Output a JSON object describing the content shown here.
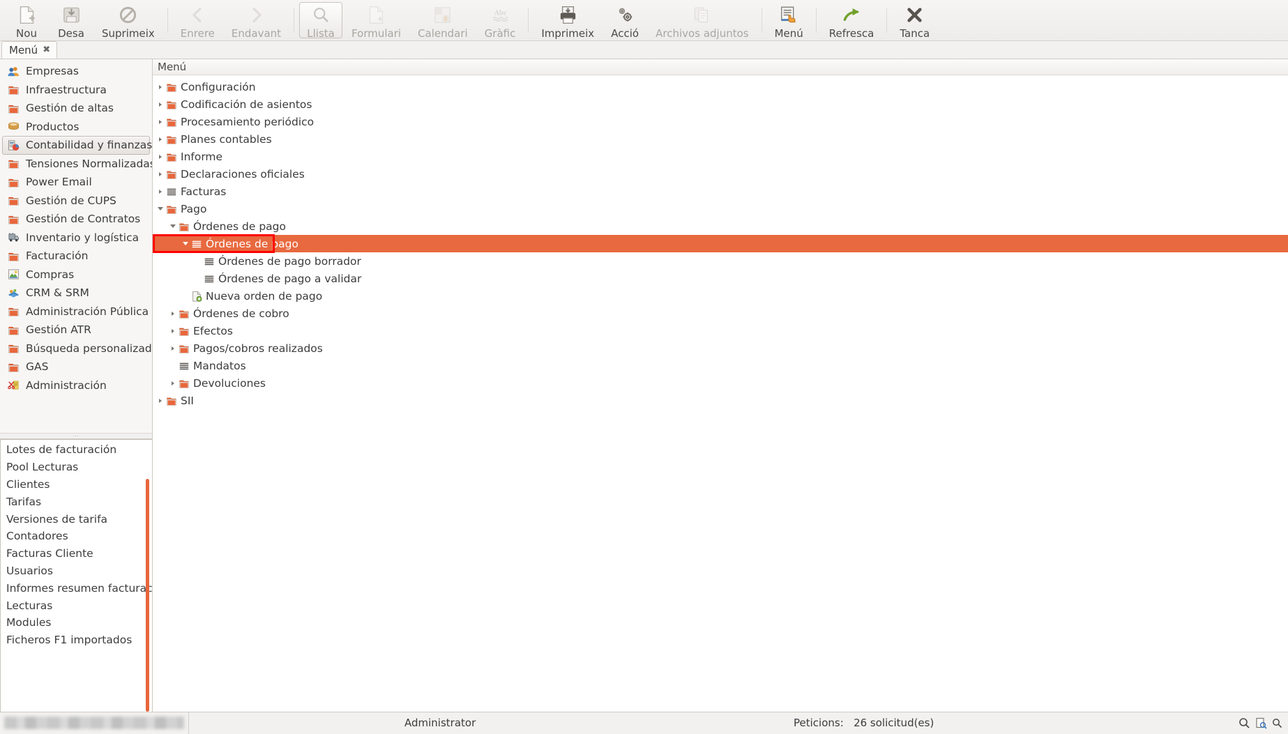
{
  "toolbar": {
    "buttons": [
      {
        "label": "Nou",
        "icon": "new-document-icon",
        "enabled": true,
        "active": false
      },
      {
        "label": "Desa",
        "icon": "save-icon",
        "enabled": true,
        "active": false
      },
      {
        "label": "Suprimeix",
        "icon": "delete-forbidden-icon",
        "enabled": true,
        "active": false
      },
      {
        "label": "Enrere",
        "icon": "chevron-left-icon",
        "enabled": false,
        "active": false
      },
      {
        "label": "Endavant",
        "icon": "chevron-right-icon",
        "enabled": false,
        "active": false
      },
      {
        "label": "Llista",
        "icon": "magnifier-list-icon",
        "enabled": false,
        "active": true
      },
      {
        "label": "Formulari",
        "icon": "form-icon",
        "enabled": false,
        "active": false
      },
      {
        "label": "Calendari",
        "icon": "calendar-icon",
        "enabled": false,
        "active": false
      },
      {
        "label": "Gràfic",
        "icon": "chart-abc-icon",
        "enabled": false,
        "active": false
      },
      {
        "label": "Imprimeix",
        "icon": "printer-icon",
        "enabled": true,
        "active": false
      },
      {
        "label": "Acció",
        "icon": "gears-icon",
        "enabled": true,
        "active": false
      },
      {
        "label": "Archivos adjuntos",
        "icon": "clipboard-icon",
        "enabled": false,
        "active": false
      },
      {
        "label": "Menú",
        "icon": "menu-hand-icon",
        "enabled": true,
        "active": false
      },
      {
        "label": "Refresca",
        "icon": "refresh-arrow-icon",
        "enabled": true,
        "active": false
      },
      {
        "label": "Tanca",
        "icon": "close-x-icon",
        "enabled": true,
        "active": false
      }
    ],
    "separators_after": [
      2,
      4,
      8,
      11,
      12,
      13
    ]
  },
  "tabs": [
    {
      "label": "Menú",
      "close_icon": "✖",
      "active": true
    }
  ],
  "sidebar": {
    "items": [
      {
        "label": "Empresas",
        "icon": "users-icon",
        "selected": false
      },
      {
        "label": "Infraestructura",
        "icon": "folder-icon",
        "selected": false
      },
      {
        "label": "Gestión de altas",
        "icon": "folder-icon",
        "selected": false
      },
      {
        "label": "Productos",
        "icon": "box-icon",
        "selected": false
      },
      {
        "label": "Contabilidad y finanzas",
        "icon": "accounting-icon",
        "selected": true
      },
      {
        "label": "Tensiones Normalizadas",
        "icon": "folder-icon",
        "selected": false
      },
      {
        "label": "Power Email",
        "icon": "folder-icon",
        "selected": false
      },
      {
        "label": "Gestión de CUPS",
        "icon": "folder-icon",
        "selected": false
      },
      {
        "label": "Gestión de Contratos",
        "icon": "folder-icon",
        "selected": false
      },
      {
        "label": "Inventario y logística",
        "icon": "truck-icon",
        "selected": false
      },
      {
        "label": "Facturación",
        "icon": "folder-icon",
        "selected": false
      },
      {
        "label": "Compras",
        "icon": "cart-icon",
        "selected": false
      },
      {
        "label": "CRM & SRM",
        "icon": "crm-icon",
        "selected": false
      },
      {
        "label": "Administración Pública",
        "icon": "folder-icon",
        "selected": false
      },
      {
        "label": "Gestión ATR",
        "icon": "folder-icon",
        "selected": false
      },
      {
        "label": "Búsqueda personalizada",
        "icon": "folder-icon",
        "selected": false
      },
      {
        "label": "GAS",
        "icon": "folder-icon",
        "selected": false
      },
      {
        "label": "Administración",
        "icon": "admin-tools-icon",
        "selected": false
      }
    ]
  },
  "shortcut_panel": {
    "items": [
      "Lotes de facturación",
      "Pool Lecturas",
      "Clientes",
      "Tarifas",
      "Versiones de tarifa",
      "Contadores",
      "Facturas Cliente",
      "Usuarios",
      "Informes resumen facturación",
      "Lecturas",
      "Modules",
      "Ficheros F1 importados"
    ],
    "scrollbar_color": "#e8663c"
  },
  "tree": {
    "header": "Menú",
    "nodes": [
      {
        "label": "Configuración",
        "depth": 0,
        "icon": "folder-icon",
        "twisty": "collapsed",
        "selected": false
      },
      {
        "label": "Codificación de asientos",
        "depth": 0,
        "icon": "folder-icon",
        "twisty": "collapsed",
        "selected": false
      },
      {
        "label": "Procesamiento periódico",
        "depth": 0,
        "icon": "folder-icon",
        "twisty": "collapsed",
        "selected": false
      },
      {
        "label": "Planes contables",
        "depth": 0,
        "icon": "folder-icon",
        "twisty": "collapsed",
        "selected": false
      },
      {
        "label": "Informe",
        "depth": 0,
        "icon": "folder-icon",
        "twisty": "collapsed",
        "selected": false
      },
      {
        "label": "Declaraciones oficiales",
        "depth": 0,
        "icon": "folder-icon",
        "twisty": "collapsed",
        "selected": false
      },
      {
        "label": "Facturas",
        "depth": 0,
        "icon": "list-icon",
        "twisty": "collapsed",
        "selected": false
      },
      {
        "label": "Pago",
        "depth": 0,
        "icon": "folder-icon",
        "twisty": "expanded",
        "selected": false
      },
      {
        "label": "Órdenes de pago",
        "depth": 1,
        "icon": "folder-icon",
        "twisty": "expanded",
        "selected": false
      },
      {
        "label": "Órdenes de pago",
        "depth": 2,
        "icon": "list-icon",
        "twisty": "expanded",
        "selected": true
      },
      {
        "label": "Órdenes de pago borrador",
        "depth": 3,
        "icon": "list-icon",
        "twisty": "none",
        "selected": false
      },
      {
        "label": "Órdenes de pago a validar",
        "depth": 3,
        "icon": "list-icon",
        "twisty": "none",
        "selected": false
      },
      {
        "label": "Nueva orden de pago",
        "depth": 2,
        "icon": "new-doc-icon",
        "twisty": "none",
        "selected": false
      },
      {
        "label": "Órdenes de cobro",
        "depth": 1,
        "icon": "folder-icon",
        "twisty": "collapsed",
        "selected": false
      },
      {
        "label": "Efectos",
        "depth": 1,
        "icon": "folder-icon",
        "twisty": "collapsed",
        "selected": false
      },
      {
        "label": "Pagos/cobros realizados",
        "depth": 1,
        "icon": "folder-icon",
        "twisty": "collapsed",
        "selected": false
      },
      {
        "label": "Mandatos",
        "depth": 1,
        "icon": "list-icon",
        "twisty": "none",
        "selected": false
      },
      {
        "label": "Devoluciones",
        "depth": 1,
        "icon": "folder-icon",
        "twisty": "collapsed",
        "selected": false
      },
      {
        "label": "SII",
        "depth": 0,
        "icon": "folder-icon",
        "twisty": "collapsed",
        "selected": false
      }
    ],
    "selection_highlight_color": "#e8693f",
    "annotation_box_color": "#ff0000"
  },
  "statusbar": {
    "user": "Administrator",
    "requests_label": "Peticions:",
    "requests_value": "26 solicitud(es)",
    "icons": [
      "search-icon",
      "document-search-icon",
      "magnifier-small-icon"
    ]
  }
}
